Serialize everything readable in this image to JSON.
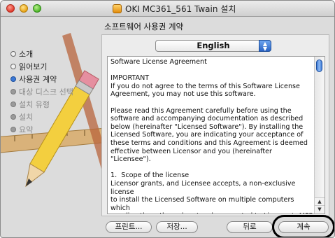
{
  "window": {
    "title": "OKI MC361_561 Twain 설치",
    "title_icon": "installer-package-icon"
  },
  "page": {
    "subtitle": "소프트웨어 사용권 계약"
  },
  "sidebar": {
    "steps": [
      {
        "label": "소개",
        "state": "done"
      },
      {
        "label": "읽어보기",
        "state": "done"
      },
      {
        "label": "사용권 계약",
        "state": "current"
      },
      {
        "label": "대상 디스크 선택",
        "state": "pending"
      },
      {
        "label": "설치 유형",
        "state": "pending"
      },
      {
        "label": "설치",
        "state": "pending"
      },
      {
        "label": "요약",
        "state": "pending"
      }
    ]
  },
  "license": {
    "language_selected": "English",
    "text": "Software License Agreement\n\nIMPORTANT\nIf you do not agree to the terms of this Software License\nAgreement, you may not use this software.\n\nPlease read this Agreement carefully before using the\nsoftware and accompanying documentation as described\nbelow (hereinafter \"Licensed Software\"). By installing the\nLicensed Software, you are indicating your acceptance of\nthese terms and conditions and this Agreement is deemed\neffective between Licensor and you (hereinafter \"Licensee\").\n\n1.  Scope of the license\nLicensor grants, and Licensee accepts, a non-exclusive license\nto install the Licensed Software on multiple computers which\nare directly or through network connected to Licensor's MFP\nproduct purchased by Licensee (\"MFP\") and to use the"
  },
  "buttons": {
    "print": "프린트...",
    "save": "저장...",
    "back": "뒤로",
    "continue": "계속"
  },
  "colors": {
    "accent": "#3b78d6",
    "window_bg": "#dcdcdc",
    "highlight": "#000000"
  }
}
